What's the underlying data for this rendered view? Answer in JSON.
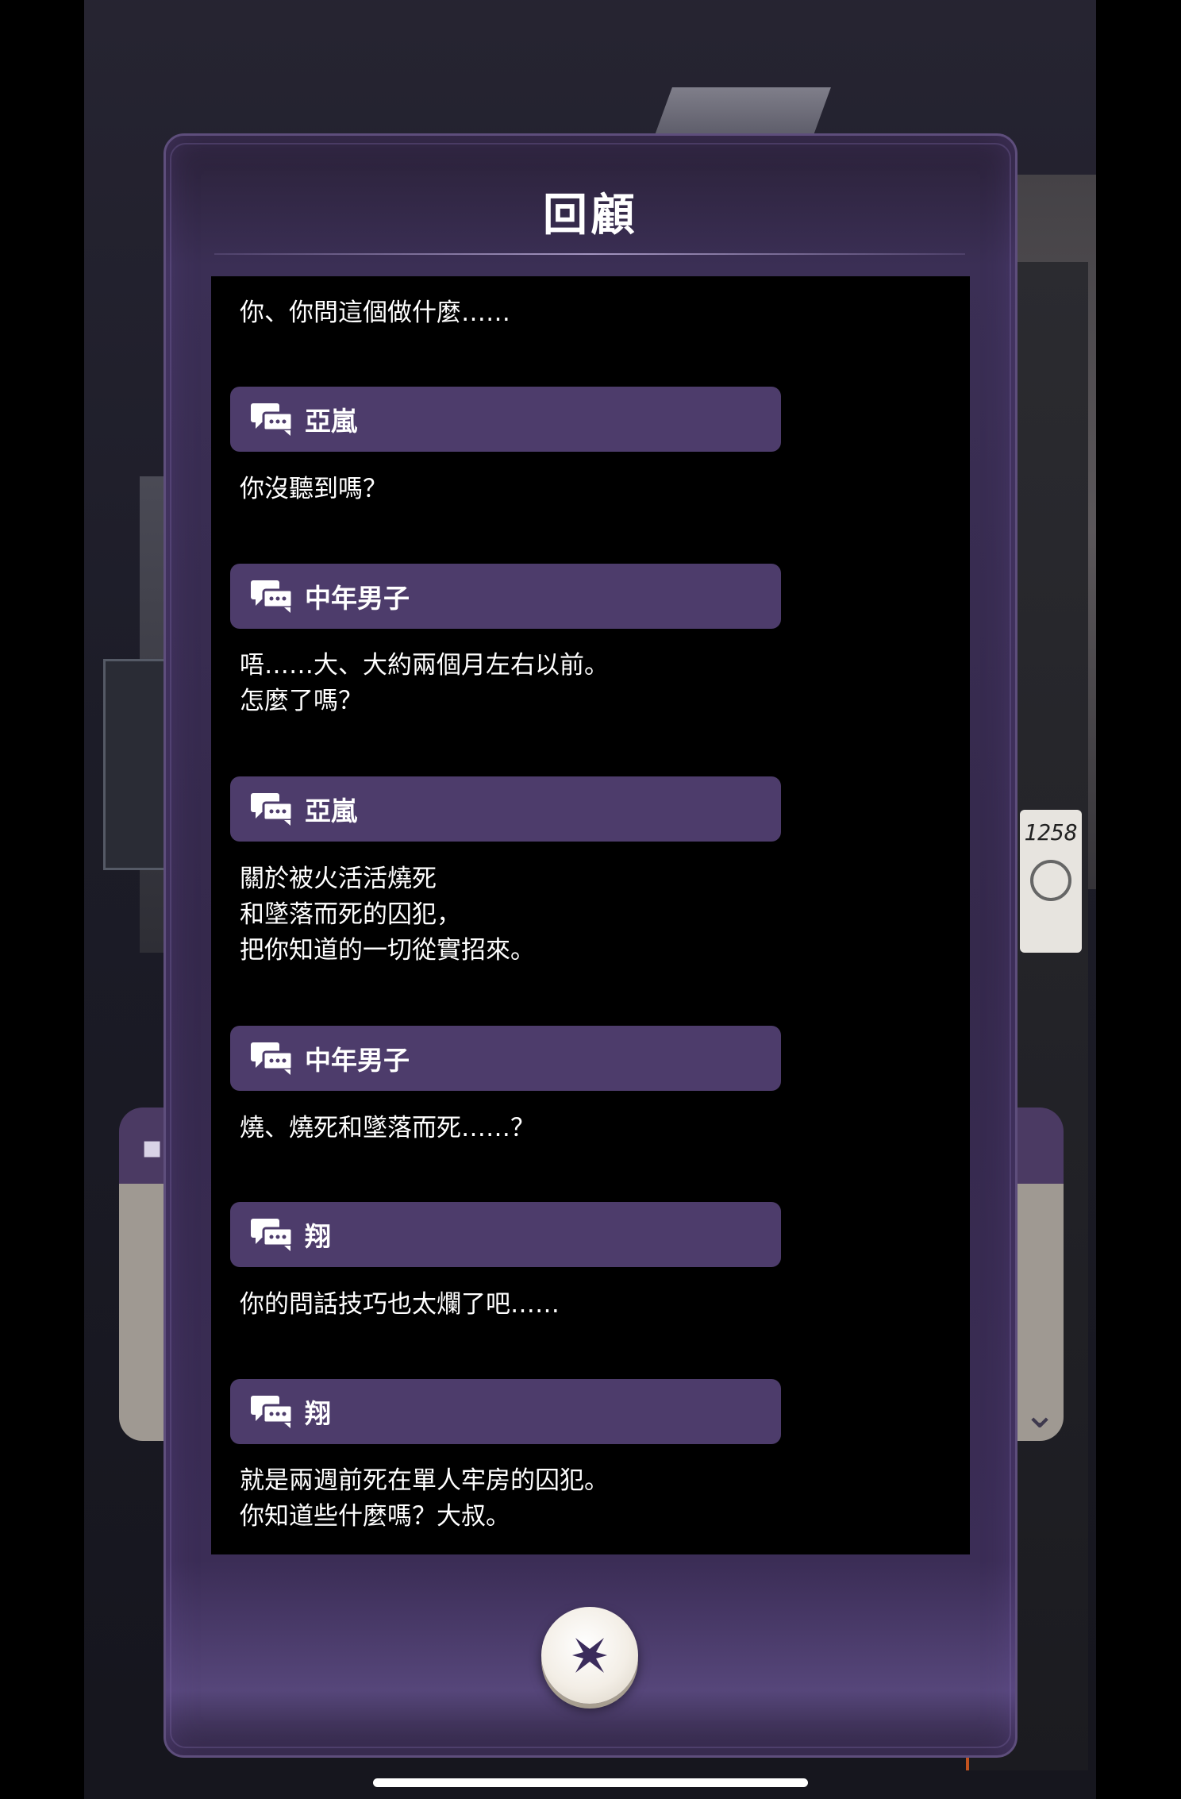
{
  "background": {
    "badge_number": "1258"
  },
  "review": {
    "title": "回顧",
    "entries": [
      {
        "speaker": "",
        "lines": [
          "你、你問這個做什麼……"
        ]
      },
      {
        "speaker": "亞嵐",
        "lines": [
          "你沒聽到嗎？"
        ]
      },
      {
        "speaker": "中年男子",
        "lines": [
          "唔……大、大約兩個月左右以前。",
          "怎麼了嗎？"
        ]
      },
      {
        "speaker": "亞嵐",
        "lines": [
          "關於被火活活燒死",
          "和墜落而死的囚犯，",
          "把你知道的一切從實招來。"
        ]
      },
      {
        "speaker": "中年男子",
        "lines": [
          "燒、燒死和墜落而死……？"
        ]
      },
      {
        "speaker": "翔",
        "lines": [
          "你的問話技巧也太爛了吧……"
        ]
      },
      {
        "speaker": "翔",
        "lines": [
          "就是兩週前死在單人牢房的囚犯。",
          "你知道些什麼嗎？大叔。"
        ]
      }
    ]
  },
  "colors": {
    "speaker_bar": "#4d3c6b",
    "panel": "#35294c",
    "log_background": "#000000",
    "close_icon": "#3b2c5c"
  },
  "icons": {
    "speaker": "speech-bubbles-icon",
    "close": "close-x-icon"
  }
}
